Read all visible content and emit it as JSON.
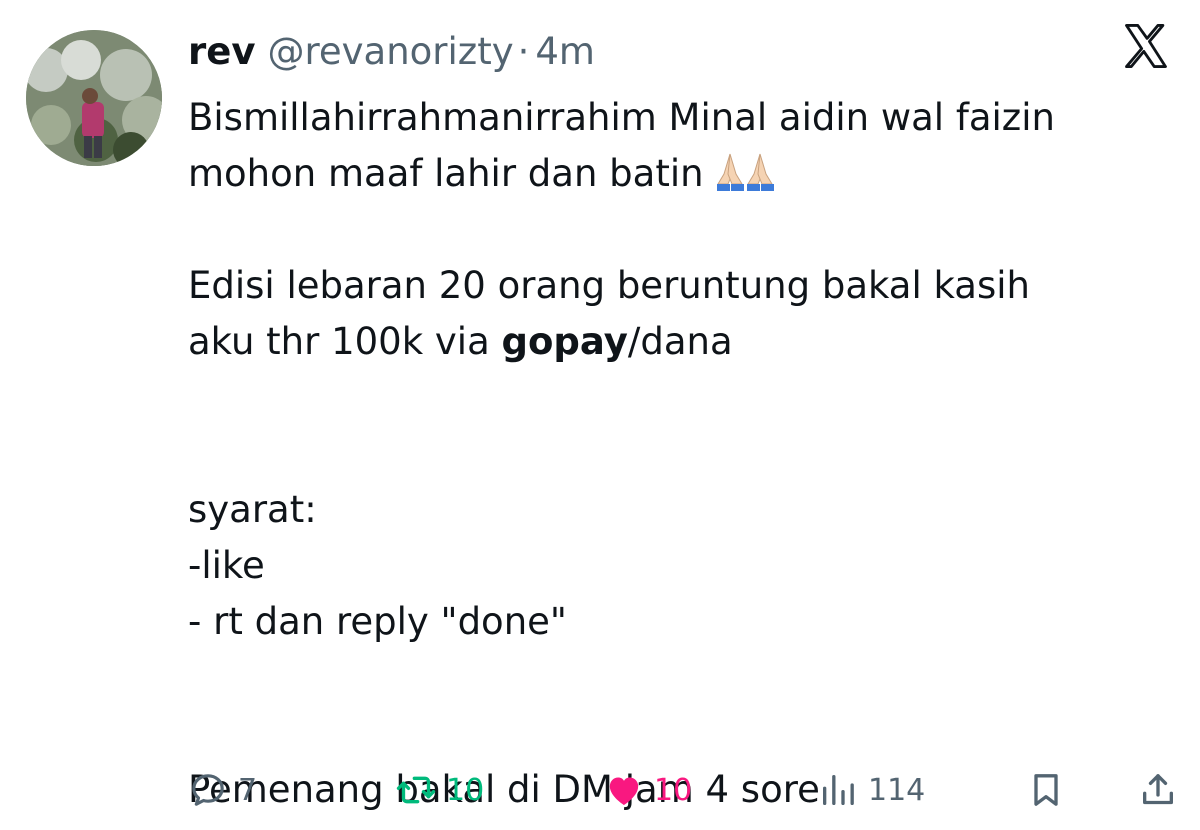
{
  "tweet": {
    "display_name": "rev",
    "handle": "@revanorizty",
    "separator": "·",
    "time": "4m",
    "lines": [
      "Bismillahirrahmanirrahim Minal aidin wal faizin",
      "mohon maaf lahir dan batin",
      "",
      "Edisi lebaran 20 orang beruntung bakal kasih",
      "",
      "",
      "syarat:",
      "-like",
      "- rt dan reply \"done\"",
      "",
      "Pemenang bakal di DM jam 4 sore"
    ],
    "line5_prefix": "aku thr 100k via ",
    "line5_bold": "gopay",
    "line5_suffix": "/dana",
    "emoji": "folded-hands-emoji"
  },
  "actions": {
    "replies": "7",
    "retweets": "10",
    "likes": "10",
    "views": "114"
  },
  "colors": {
    "text": "#0f1419",
    "secondary": "#536471",
    "retweet": "#00ba7c",
    "like": "#f91880"
  },
  "icons": [
    "x-logo-icon",
    "reply-icon",
    "retweet-icon",
    "heart-icon",
    "views-icon",
    "bookmark-icon",
    "share-icon"
  ]
}
